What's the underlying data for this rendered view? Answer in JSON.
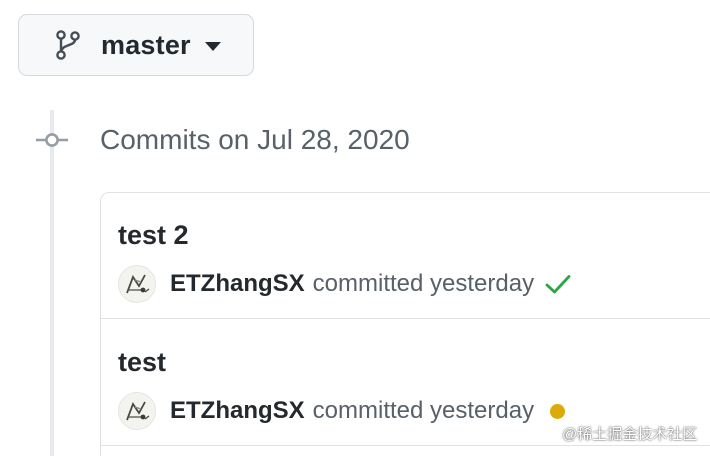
{
  "branch": {
    "name": "master",
    "icon": "git-branch-icon",
    "caret_icon": "triangle-down-icon"
  },
  "timeline": {
    "heading": "Commits on Jul 28, 2020",
    "node_icon": "git-commit-icon"
  },
  "commits": [
    {
      "title": "test 2",
      "author": "ETZhangSX",
      "time_text": "committed yesterday",
      "status": "success",
      "status_icon": "check-icon",
      "status_color": "#28a745"
    },
    {
      "title": "test",
      "author": "ETZhangSX",
      "time_text": "committed yesterday",
      "status": "pending",
      "status_icon": "dot-icon",
      "status_color": "#dbab09"
    }
  ],
  "watermark": "@稀土掘金技术社区"
}
